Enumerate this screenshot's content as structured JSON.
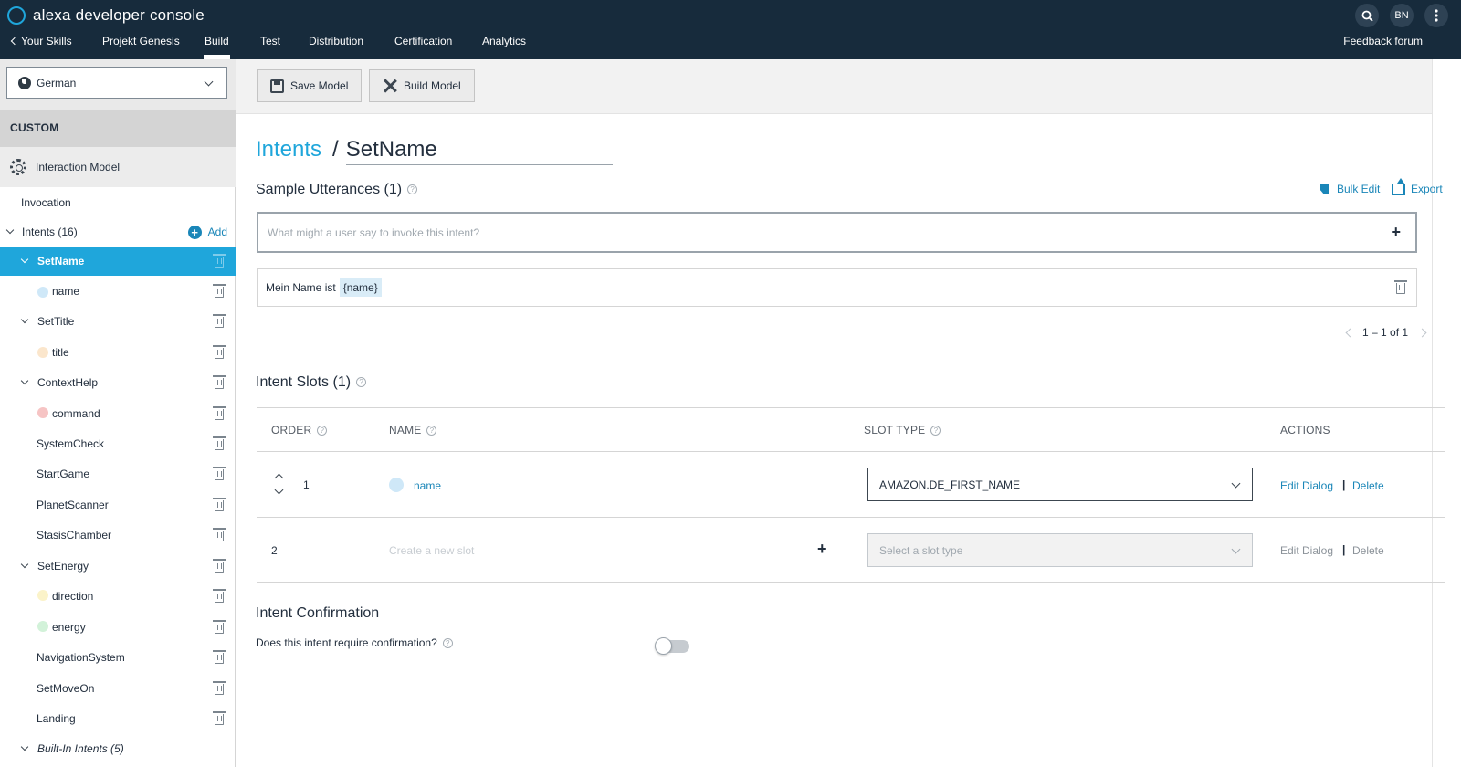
{
  "header": {
    "app_title": "alexa developer console",
    "avatar_initials": "BN",
    "nav": {
      "back_label": "Your Skills",
      "tabs": [
        "Projekt Genesis",
        "Build",
        "Test",
        "Distribution",
        "Certification",
        "Analytics"
      ],
      "active_tab": "Build",
      "feedback_label": "Feedback forum"
    }
  },
  "sidebar": {
    "language": "German",
    "section_label": "CUSTOM",
    "interaction_model_label": "Interaction Model",
    "invocation_label": "Invocation",
    "intents_label": "Intents (16)",
    "add_label": "Add",
    "items": [
      {
        "label": "SetName"
      },
      {
        "label": "name",
        "dot_color": "#cfe8f8"
      },
      {
        "label": "SetTitle"
      },
      {
        "label": "title",
        "dot_color": "#fbe6cc"
      },
      {
        "label": "ContextHelp"
      },
      {
        "label": "command",
        "dot_color": "#f6c4c4"
      },
      {
        "label": "SystemCheck"
      },
      {
        "label": "StartGame"
      },
      {
        "label": "PlanetScanner"
      },
      {
        "label": "StasisChamber"
      },
      {
        "label": "SetEnergy"
      },
      {
        "label": "direction",
        "dot_color": "#fbf3c9"
      },
      {
        "label": "energy",
        "dot_color": "#d2f2d9"
      },
      {
        "label": "NavigationSystem"
      },
      {
        "label": "SetMoveOn"
      },
      {
        "label": "Landing"
      }
    ],
    "builtin_label": "Built-In Intents (5)"
  },
  "toolbar": {
    "save_label": "Save Model",
    "build_label": "Build Model"
  },
  "main": {
    "breadcrumb_link": "Intents",
    "breadcrumb_sep": "/",
    "intent_name": "SetName",
    "utterances": {
      "title": "Sample Utterances (1)",
      "bulk_edit_label": "Bulk Edit",
      "export_label": "Export",
      "input_placeholder": "What might a user say to invoke this intent?",
      "items": [
        {
          "text": "Mein Name ist",
          "slot": "{name}"
        }
      ],
      "pager": "1 – 1 of 1"
    },
    "slots": {
      "title": "Intent Slots (1)",
      "columns": {
        "order": "ORDER",
        "name": "NAME",
        "slot_type": "SLOT TYPE",
        "actions": "ACTIONS"
      },
      "rows": [
        {
          "order": "1",
          "name": "name",
          "slot_type": "AMAZON.DE_FIRST_NAME",
          "dot_color": "#cfe8f8"
        },
        {
          "order": "2",
          "name_placeholder": "Create a new slot",
          "slot_type_placeholder": "Select a slot type"
        }
      ],
      "edit_dialog_label": "Edit Dialog",
      "action_sep": "|",
      "delete_label": "Delete"
    },
    "confirmation": {
      "title": "Intent Confirmation",
      "question": "Does this intent require confirmation?",
      "enabled": false
    }
  },
  "colors": {
    "header_bg": "#172b3c",
    "accent": "#1fa6db",
    "link": "#1a86b8"
  }
}
